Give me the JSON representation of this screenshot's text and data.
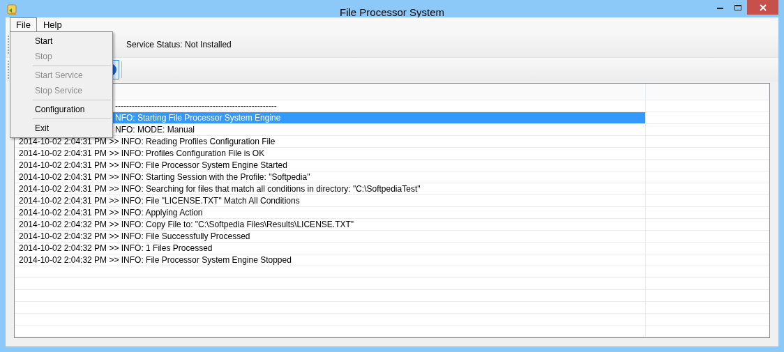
{
  "window": {
    "title": "File Processor System"
  },
  "menu_bar": [
    {
      "label": "File",
      "selected": true
    },
    {
      "label": "Help",
      "selected": false
    }
  ],
  "file_menu": [
    {
      "kind": "item",
      "label": "Start",
      "disabled": false
    },
    {
      "kind": "item",
      "label": "Stop",
      "disabled": true
    },
    {
      "kind": "separator"
    },
    {
      "kind": "item",
      "label": "Start Service",
      "disabled": true
    },
    {
      "kind": "item",
      "label": "Stop Service",
      "disabled": true
    },
    {
      "kind": "separator"
    },
    {
      "kind": "item",
      "label": "Configuration",
      "disabled": false
    },
    {
      "kind": "separator"
    },
    {
      "kind": "item",
      "label": "Exit",
      "disabled": false
    }
  ],
  "service_status": "Service Status: Not Installed",
  "log": [
    {
      "text": "----------------------------------------------------------",
      "selected": false,
      "under_menu": true
    },
    {
      "text": "NFO: Starting File Processor System Engine",
      "selected": true,
      "under_menu": true
    },
    {
      "text": "NFO: MODE: Manual",
      "selected": false,
      "under_menu": true
    },
    {
      "text": "2014-10-02 2:04:31 PM >> INFO: Reading Profiles Configuration File",
      "selected": false,
      "under_menu": false
    },
    {
      "text": "2014-10-02 2:04:31 PM >> INFO: Profiles Configuration File is OK",
      "selected": false,
      "under_menu": false
    },
    {
      "text": "2014-10-02 2:04:31 PM >> INFO: File Processor System Engine Started",
      "selected": false,
      "under_menu": false
    },
    {
      "text": "2014-10-02 2:04:31 PM >> INFO: Starting Session with the Profile: \"Softpedia\"",
      "selected": false,
      "under_menu": false
    },
    {
      "text": "2014-10-02 2:04:31 PM >> INFO: Searching for files that match all conditions in directory: \"C:\\SoftpediaTest\"",
      "selected": false,
      "under_menu": false
    },
    {
      "text": "2014-10-02 2:04:31 PM >> INFO: File \"LICENSE.TXT\" Match All Conditions",
      "selected": false,
      "under_menu": false
    },
    {
      "text": "2014-10-02 2:04:31 PM >> INFO: Applying Action",
      "selected": false,
      "under_menu": false
    },
    {
      "text": "2014-10-02 2:04:32 PM >> INFO: Copy File to: \"C:\\Softpedia Files\\Results\\LICENSE.TXT\"",
      "selected": false,
      "under_menu": false
    },
    {
      "text": "2014-10-02 2:04:32 PM >> INFO: File Successfully Processed",
      "selected": false,
      "under_menu": false
    },
    {
      "text": "2014-10-02 2:04:32 PM >> INFO: 1 Files Processed",
      "selected": false,
      "under_menu": false
    },
    {
      "text": "2014-10-02 2:04:32 PM >> INFO: File Processor System Engine Stopped",
      "selected": false,
      "under_menu": false
    }
  ]
}
